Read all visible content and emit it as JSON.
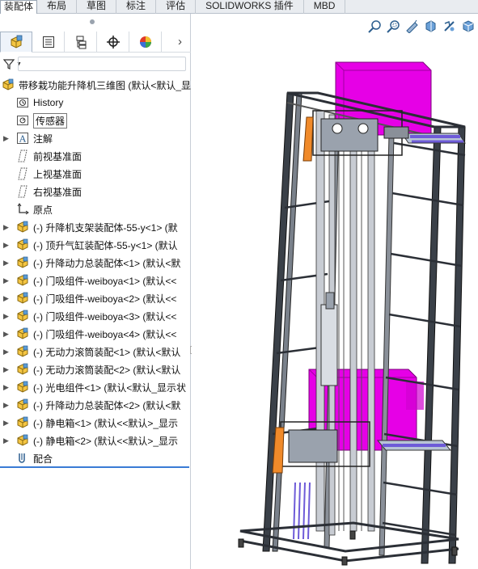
{
  "ribbon": {
    "tabs": [
      {
        "label": "装配体",
        "active": true
      },
      {
        "label": "布局",
        "active": false
      },
      {
        "label": "草图",
        "active": false
      },
      {
        "label": "标注",
        "active": false
      },
      {
        "label": "评估",
        "active": false
      },
      {
        "label": "SOLIDWORKS 插件",
        "active": false
      },
      {
        "label": "MBD",
        "active": false
      }
    ]
  },
  "feature_manager": {
    "tabs": [
      "feature-manager-tree",
      "property-manager",
      "configuration-manager",
      "dimxpert-manager",
      "display-manager"
    ],
    "more_arrow": "›",
    "root": {
      "label": "带移栽功能升降机三维图 (默认<默认_显"
    },
    "items": [
      {
        "label": "History",
        "icon": "history-icon"
      },
      {
        "label": "传感器",
        "icon": "sensor-icon"
      },
      {
        "label": "注解",
        "icon": "annotation-icon"
      },
      {
        "label": "前视基准面",
        "icon": "plane-icon"
      },
      {
        "label": "上视基准面",
        "icon": "plane-icon"
      },
      {
        "label": "右视基准面",
        "icon": "plane-icon"
      },
      {
        "label": "原点",
        "icon": "origin-icon"
      },
      {
        "label": "(-) 升降机支架装配体-55-y<1> (默",
        "icon": "subassembly-icon"
      },
      {
        "label": "(-) 顶升气缸装配体-55-y<1> (默认",
        "icon": "subassembly-icon"
      },
      {
        "label": "(-) 升降动力总装配体<1> (默认<默",
        "icon": "subassembly-icon"
      },
      {
        "label": "(-) 门吸组件-weiboya<1> (默认<<",
        "icon": "subassembly-icon"
      },
      {
        "label": "(-) 门吸组件-weiboya<2> (默认<<",
        "icon": "subassembly-icon"
      },
      {
        "label": "(-) 门吸组件-weiboya<3> (默认<<",
        "icon": "subassembly-icon"
      },
      {
        "label": "(-) 门吸组件-weiboya<4> (默认<<",
        "icon": "subassembly-icon"
      },
      {
        "label": "(-) 无动力滚筒装配<1> (默认<默认",
        "icon": "subassembly-icon"
      },
      {
        "label": "(-) 无动力滚筒装配<2> (默认<默认",
        "icon": "subassembly-icon"
      },
      {
        "label": "(-) 光电组件<1> (默认<默认_显示状",
        "icon": "subassembly-icon"
      },
      {
        "label": "(-) 升降动力总装配体<2> (默认<默",
        "icon": "subassembly-icon"
      },
      {
        "label": "(-) 静电箱<1> (默认<<默认>_显示",
        "icon": "subassembly-icon"
      },
      {
        "label": "(-) 静电箱<2> (默认<<默认>_显示",
        "icon": "subassembly-icon"
      },
      {
        "label": "配合",
        "icon": "mates-icon"
      }
    ]
  },
  "viewport": {
    "hud_icons": [
      "zoom-to-fit-icon",
      "zoom-to-area-icon",
      "previous-view-icon",
      "section-view-icon",
      "view-orientation-icon",
      "display-style-icon"
    ]
  },
  "colors": {
    "accent": "#3a7bd5",
    "part_magenta": "#e600e6",
    "frame_gray": "#8a8f98",
    "frame_dark": "#2b2f36",
    "rod_purple": "#6e5bd8",
    "motor_orange": "#f08a2a"
  }
}
